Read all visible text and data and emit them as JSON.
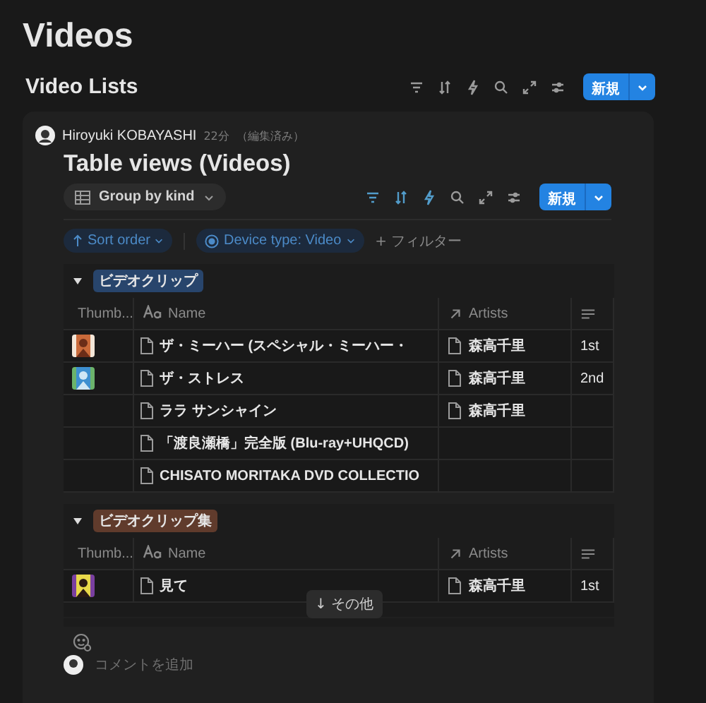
{
  "page_title": "Videos",
  "section": {
    "title": "Video Lists",
    "new_button": "新規"
  },
  "post": {
    "author": "Hiroyuki KOBAYASHI",
    "time": "22分",
    "edited": "（編集済み）",
    "title": "Table views (Videos)",
    "view_button": "Group by kind",
    "new_button": "新規",
    "filters": [
      {
        "kind": "sort",
        "label": "Sort order"
      },
      {
        "kind": "property",
        "label": "Device type: Video"
      }
    ],
    "add_filter": "+ フィルター",
    "groups": [
      {
        "label": "ビデオクリップ",
        "color": "#28456c",
        "expanded": true,
        "columns": [
          {
            "kind": "thumb",
            "label": "Thumb..."
          },
          {
            "kind": "title",
            "label": "Name"
          },
          {
            "kind": "relation",
            "label": "Artists"
          },
          {
            "kind": "text"
          }
        ],
        "rows": [
          {
            "has_thumbnail": true,
            "name": "ザ・ミーハー (スペシャル・ミーハー・",
            "artist": "森高千里",
            "column_4": "1st"
          },
          {
            "has_thumbnail": true,
            "name": "ザ・ストレス",
            "artist": "森高千里",
            "column_4": "2nd"
          },
          {
            "has_thumbnail": false,
            "name": "ララ サンシャイン",
            "artist": "森高千里"
          },
          {
            "has_thumbnail": false,
            "name": "「渡良瀬橋」完全版 (Blu-ray+UHQCD)"
          },
          {
            "has_thumbnail": false,
            "name": "CHISATO MORITAKA DVD COLLECTIO"
          }
        ]
      },
      {
        "label": "ビデオクリップ集",
        "color": "#603b2c",
        "expanded": true,
        "columns": [
          {
            "kind": "thumb",
            "label": "Thumb..."
          },
          {
            "kind": "title",
            "label": "Name"
          },
          {
            "kind": "relation",
            "label": "Artists"
          },
          {
            "kind": "text"
          }
        ],
        "rows": [
          {
            "has_thumbnail": true,
            "name": "見て",
            "artist": "森高千里",
            "column_4": "1st"
          }
        ]
      }
    ],
    "more_button": "↓ その他",
    "comment_placeholder": "コメントを追加"
  }
}
